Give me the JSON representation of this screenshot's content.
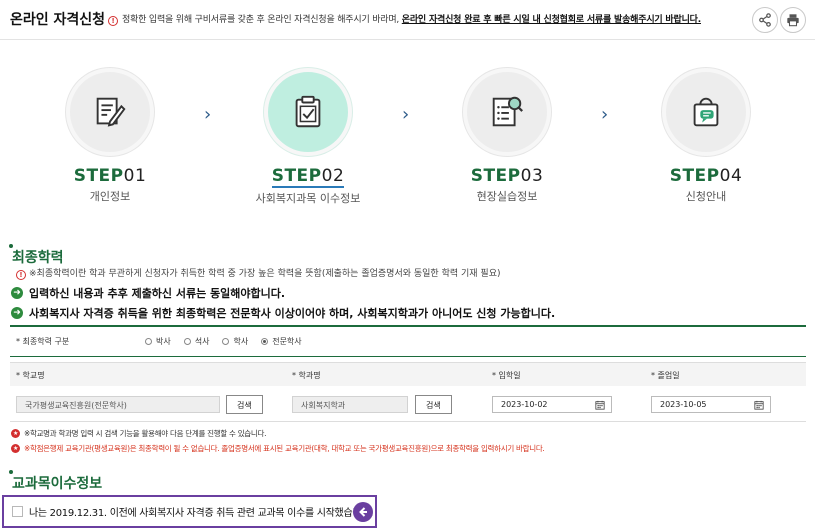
{
  "header": {
    "title": "온라인 자격신청",
    "notice_plain": "정확한 입력을 위해 구비서류를 갖춘 후 온라인 자격신청을 해주시기 바라며,",
    "notice_strong": "온라인 자격신청 완료 후 빠른 시일 내 신청협회로 서류를 발송해주시기 바랍니다.",
    "share_icon": "share-icon",
    "print_icon": "print-icon"
  },
  "steps": [
    {
      "prefix": "STEP",
      "num": "01",
      "label": "개인정보",
      "icon": "edit-document-icon"
    },
    {
      "prefix": "STEP",
      "num": "02",
      "label": "사회복지과목 이수정보",
      "icon": "clipboard-check-icon"
    },
    {
      "prefix": "STEP",
      "num": "03",
      "label": "현장실습정보",
      "icon": "document-search-icon"
    },
    {
      "prefix": "STEP",
      "num": "04",
      "label": "신청안내",
      "icon": "shopping-bag-chat-icon"
    }
  ],
  "arrow_glyph": "›",
  "final_education": {
    "title": "최종학력",
    "info": "※최종학력이란 학과 무관하게 신청자가 취득한 학력 중 가장 높은 학력을 뜻함(제출하는 졸업증명서와 동일한 학력 기재 필요)",
    "line1": "입력하신 내용과 추후 제출하신 서류는 동일해야합니다.",
    "line2": "사회복지사 자격증 취득을 위한 최종학력은 전문학사 이상이어야 하며, 사회복지학과가 아니어도 신청 가능합니다.",
    "degree_label": "* 최종학력 구분",
    "degree_options": [
      "박사",
      "석사",
      "학사",
      "전문학사"
    ],
    "degree_selected": "전문학사",
    "col_school": "* 학교명",
    "col_major": "* 학과명",
    "col_entry": "* 입학일",
    "col_grad": "* 졸업일",
    "school_value": "국가평생교육진흥원(전문학사)",
    "major_value": "사회복지학과",
    "search_label": "검색",
    "entry_date": "2023-10-02",
    "grad_date": "2023-10-05",
    "note1": "※학교명과 학과명 입력 시 검색 기능을 활용해야 다음 단계를 진행할 수 있습니다.",
    "note2": "※학점은행제 교육기관(평생교육원)은 최종학력이 될 수 없습니다. 졸업증명서에 표시된 교육기관(대학, 대학교 또는 국가평생교육진흥원)으로 최종학력을 입력하시기 바랍니다."
  },
  "course_info": {
    "title": "교과목이수정보",
    "checkbox_label": "나는 2019.12.31. 이전에 사회복지사 자격증 취득 관련 교과목 이수를 시작했습니다."
  },
  "colors": {
    "accent_green": "#1c6b3c",
    "active_circle": "#bfeee0",
    "highlight_purple": "#6a3fa0",
    "warning_red": "#d32f2f"
  }
}
